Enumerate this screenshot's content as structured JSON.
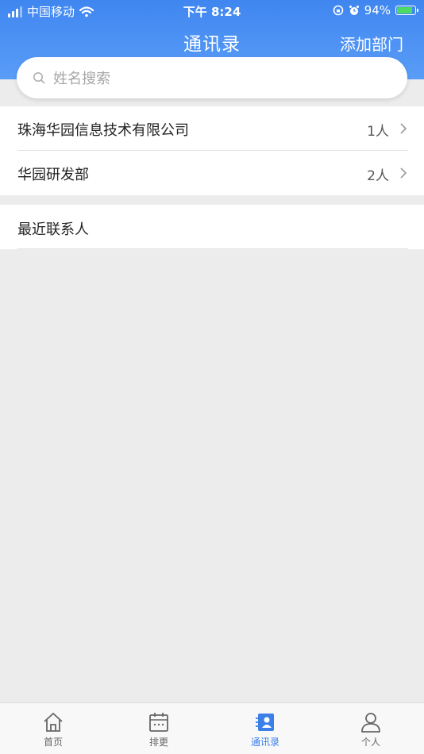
{
  "status_bar": {
    "carrier": "中国移动",
    "time": "下午 8:24",
    "battery": "94%"
  },
  "header": {
    "title": "通讯录",
    "action": "添加部门"
  },
  "search": {
    "placeholder": "姓名搜索"
  },
  "departments": [
    {
      "name": "珠海华园信息技术有限公司",
      "count": "1人"
    },
    {
      "name": "华园研发部",
      "count": "2人"
    }
  ],
  "recent": {
    "label": "最近联系人"
  },
  "tabs": [
    {
      "label": "首页"
    },
    {
      "label": "排更"
    },
    {
      "label": "通讯录"
    },
    {
      "label": "个人"
    }
  ],
  "colors": {
    "header": "#4a8ff2",
    "accent": "#3b7fe8",
    "battery_fill": "#4cd964"
  },
  "icons": [
    "signal-icon",
    "wifi-icon",
    "lock-rotation-icon",
    "alarm-icon",
    "battery-icon",
    "search-icon",
    "chevron-right-icon",
    "home-icon",
    "calendar-icon",
    "contacts-icon",
    "person-icon"
  ]
}
